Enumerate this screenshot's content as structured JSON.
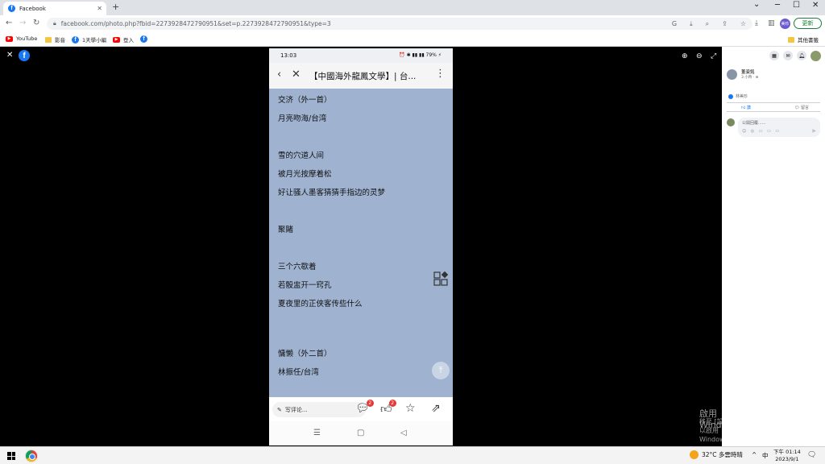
{
  "browser": {
    "tab_title": "Facebook",
    "url": "facebook.com/photo.php?fbid=227392847279095​1&set=p.2273928472790951&type=3",
    "update_label": "更新",
    "profile_initials": "美珍",
    "bookmarks": [
      {
        "label": "YouTube",
        "icon": "youtube-icon"
      },
      {
        "label": "影音",
        "icon": "folder-icon"
      },
      {
        "label": "1天學小編",
        "icon": "facebook-icon"
      },
      {
        "label": "登入",
        "icon": "youtube-icon"
      },
      {
        "label": "",
        "icon": "facebook-icon"
      }
    ],
    "other_bookmarks": "其他書籤"
  },
  "phone": {
    "status_time": "13:03",
    "status_right": "⏰ ✱ ▮▮ ▮▮ 79% ⚡",
    "header_title": "【中國海外龍鳳文學】| 台...",
    "lines": [
      "交济（外一首）",
      "月亮吻海/台湾",
      "",
      "雪的穴道人间",
      "被月光按摩着松",
      "好让骚人墨客猜猜手指边的灵梦",
      "",
      "聚賭",
      "",
      "三个六歇着",
      "若骰盅开一窍孔",
      "夏夜里的正侠客传些什么",
      "",
      "",
      "慵懒（外二首）",
      "林振任/台湾"
    ],
    "comment_placeholder": "写评论...",
    "comment_badge": "2",
    "like_badge": "2"
  },
  "rightpanel": {
    "poster_name": "董姿銘",
    "poster_time": "3 小時 · ⊕",
    "likes_text": "林美珍",
    "like_label": "讚",
    "comment_label": "留言",
    "comment_placeholder": "公開回覆......",
    "comment_icons": "☺ ◎ ▭ ▭ ▭"
  },
  "watermark": {
    "line1": "啟用 Windows",
    "line2": "移至 [設定] 以啟用 Windows。"
  },
  "taskbar": {
    "weather": "32°C 多雲時晴",
    "ime": "中",
    "time": "下午 01:14",
    "date": "2023/9/1"
  }
}
